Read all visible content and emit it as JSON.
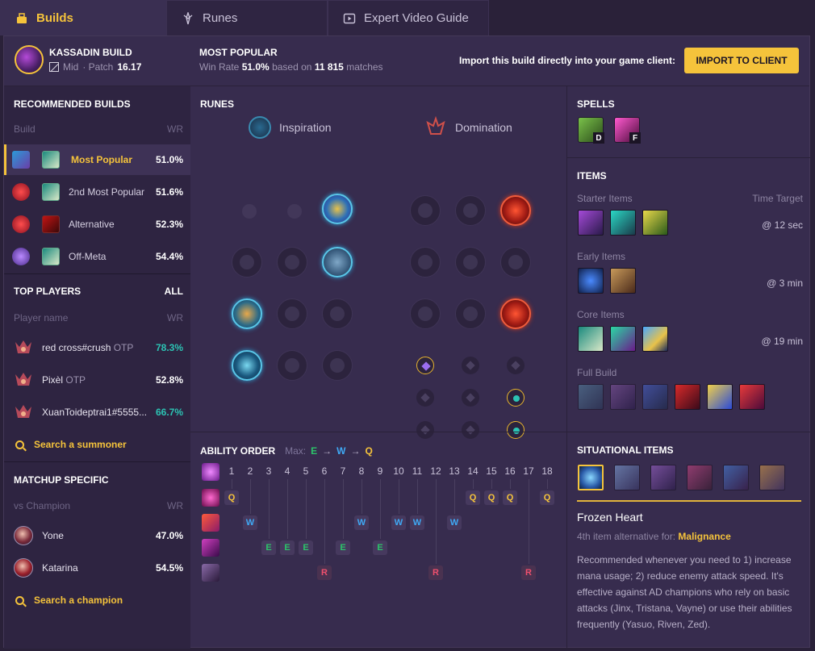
{
  "tabs": [
    {
      "label": "Builds",
      "icon": "build-icon"
    },
    {
      "label": "Runes",
      "icon": "runes-icon"
    },
    {
      "label": "Expert Video Guide",
      "icon": "video-icon"
    }
  ],
  "header": {
    "build_title": "KASSADIN BUILD",
    "role": "Mid",
    "patch_prefix": "· Patch",
    "patch": "16.17",
    "pop_title": "MOST POPULAR",
    "pop_prefix": "Win Rate",
    "pop_winrate": "51.0%",
    "pop_mid": "based on",
    "pop_matches": "11 815",
    "pop_suffix": "matches",
    "import_text": "Import this build directly into your game client:",
    "import_button": "IMPORT TO CLIENT"
  },
  "recommended": {
    "title": "RECOMMENDED BUILDS",
    "col_build": "Build",
    "col_wr": "WR",
    "rows": [
      {
        "label": "Most Popular",
        "wr": "51.0%"
      },
      {
        "label": "2nd Most Popular",
        "wr": "51.6%"
      },
      {
        "label": "Alternative",
        "wr": "52.3%"
      },
      {
        "label": "Off-Meta",
        "wr": "54.4%"
      }
    ]
  },
  "top_players": {
    "title": "TOP PLAYERS",
    "all": "ALL",
    "col_name": "Player name",
    "col_wr": "WR",
    "rows": [
      {
        "name": "red cross#crush",
        "tag": "OTP",
        "wr": "78.3%"
      },
      {
        "name": "Pixèl",
        "tag": "OTP",
        "wr": "52.8%"
      },
      {
        "name": "XuanToideptrai1#5555...",
        "tag": "",
        "wr": "66.7%"
      }
    ],
    "search": "Search a summoner"
  },
  "matchup": {
    "title": "MATCHUP SPECIFIC",
    "col_name": "vs Champion",
    "col_wr": "WR",
    "rows": [
      {
        "name": "Yone",
        "wr": "47.0%"
      },
      {
        "name": "Katarina",
        "wr": "54.5%"
      }
    ],
    "search": "Search a champion"
  },
  "runes": {
    "title": "RUNES",
    "primary": "Inspiration",
    "secondary": "Domination"
  },
  "ability": {
    "title": "ABILITY ORDER",
    "max_label": "Max:",
    "max_order": [
      "E",
      "W",
      "Q"
    ],
    "arrow": "→",
    "levels": [
      "1",
      "2",
      "3",
      "4",
      "5",
      "6",
      "7",
      "8",
      "9",
      "10",
      "11",
      "12",
      "13",
      "14",
      "15",
      "16",
      "17",
      "18"
    ],
    "sequence": [
      "Q",
      "W",
      "E",
      "E",
      "E",
      "R",
      "E",
      "W",
      "E",
      "W",
      "W",
      "R",
      "W",
      "Q",
      "Q",
      "Q",
      "R",
      "Q"
    ]
  },
  "spells": {
    "title": "SPELLS",
    "keys": [
      "D",
      "F"
    ]
  },
  "items": {
    "title": "ITEMS",
    "starter": "Starter Items",
    "time_target": "Time Target",
    "starter_time": "@ 12 sec",
    "early": "Early Items",
    "early_time": "@ 3 min",
    "core": "Core Items",
    "core_time": "@ 19 min",
    "full": "Full Build"
  },
  "situational": {
    "title": "SITUATIONAL ITEMS",
    "selected_name": "Frozen Heart",
    "alt_prefix": "4th item alternative for:",
    "alt_item": "Malignance",
    "description": "Recommended whenever you need to 1) increase mana usage; 2) reduce enemy attack speed. It's effective against AD champions who rely on basic attacks (Jinx, Tristana, Vayne) or use their abilities frequently (Yasuo, Riven, Zed)."
  },
  "colors": {
    "accent": "#f5c33b",
    "teal": "#2cc4b4",
    "bg": "#372c4e"
  }
}
